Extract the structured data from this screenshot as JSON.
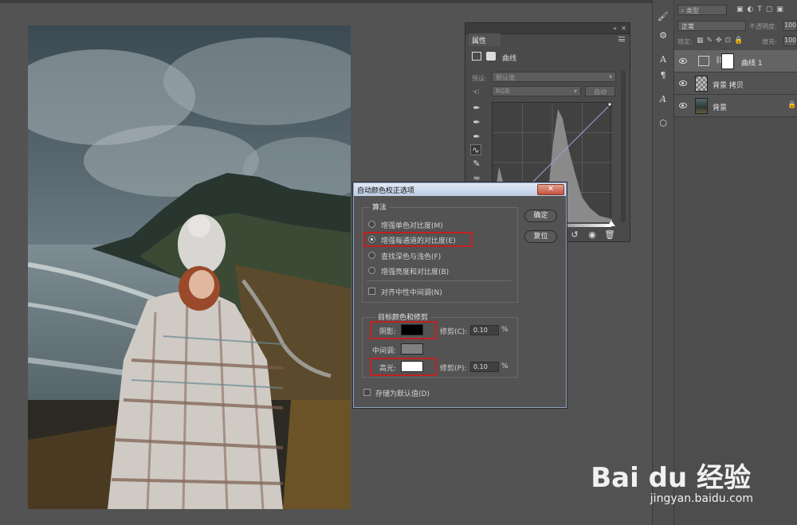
{
  "properties_panel": {
    "tab": "属性",
    "adjustment_name": "曲线",
    "preset_label": "预设:",
    "preset_value": "默认值",
    "channel_value": "RGB",
    "auto_button": "自动"
  },
  "dialog": {
    "title": "自动颜色校正选项",
    "close": "✕",
    "algorithm_group": "算法",
    "options": [
      {
        "label": "增强单色对比度(M)",
        "selected": false
      },
      {
        "label": "增强每通道的对比度(E)",
        "selected": true
      },
      {
        "label": "查找深色与浅色(F)",
        "selected": false
      },
      {
        "label": "增强亮度和对比度(B)",
        "selected": false
      }
    ],
    "snap_neutral": "对齐中性中间调(N)",
    "target_group": "目标颜色和修剪",
    "shadows_label": "阴影:",
    "midtones_label": "中间调:",
    "highlights_label": "高光:",
    "clip_shadows_label": "修剪(C):",
    "clip_shadows_value": "0.10",
    "clip_highlights_label": "修剪(P):",
    "clip_highlights_value": "0.10",
    "percent": "%",
    "save_default": "存储为默认值(D)",
    "ok_button": "确定",
    "reset_button": "复位",
    "colors": {
      "shadow": "#000000",
      "midtone": "#808080",
      "highlight": "#ffffff"
    }
  },
  "layers_panel": {
    "filter_kind": "类型",
    "blend_mode": "正常",
    "opacity_label": "不透明度:",
    "opacity_value": "100%",
    "lock_label": "锁定:",
    "fill_label": "填充:",
    "fill_value": "100%",
    "layers": [
      {
        "name": "曲线 1"
      },
      {
        "name": "背景 拷贝"
      },
      {
        "name": "背景"
      }
    ]
  },
  "watermark": {
    "text": "Bai du 经验",
    "url": "jingyan.baidu.com"
  }
}
